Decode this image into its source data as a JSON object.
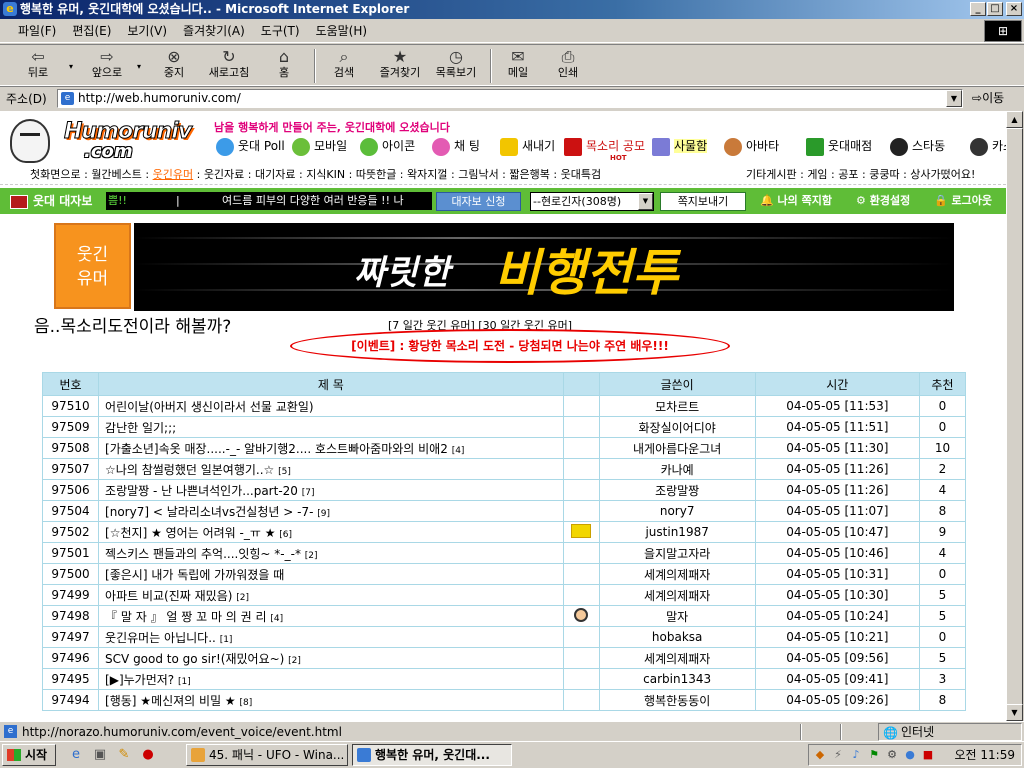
{
  "window": {
    "title": "행복한 유머, 웃긴대학에 오셨습니다.. - Microsoft Internet Explorer",
    "min": "_",
    "max": "□",
    "close": "×"
  },
  "menu": [
    "파일(F)",
    "편집(E)",
    "보기(V)",
    "즐겨찾기(A)",
    "도구(T)",
    "도움말(H)"
  ],
  "toolbar": [
    {
      "label": "뒤로",
      "icon": "back-arrow-icon",
      "glyph": "⇦"
    },
    {
      "label": "앞으로",
      "icon": "forward-arrow-icon",
      "glyph": "⇨"
    },
    {
      "label": "중지",
      "icon": "stop-icon",
      "glyph": "⊗"
    },
    {
      "label": "새로고침",
      "icon": "refresh-icon",
      "glyph": "↻"
    },
    {
      "label": "홈",
      "icon": "home-icon",
      "glyph": "⌂"
    },
    {
      "label": "검색",
      "icon": "search-icon",
      "glyph": "⌕"
    },
    {
      "label": "즐겨찾기",
      "icon": "favorites-icon",
      "glyph": "★"
    },
    {
      "label": "목록보기",
      "icon": "history-icon",
      "glyph": "◷"
    },
    {
      "label": "메일",
      "icon": "mail-icon",
      "glyph": "✉"
    },
    {
      "label": "인쇄",
      "icon": "print-icon",
      "glyph": "⎙"
    }
  ],
  "address": {
    "label": "주소(D)",
    "url": "http://web.humoruniv.com/",
    "go": "이동"
  },
  "site": {
    "logo_line1": "Humoruniv",
    "logo_line2": ".com",
    "slogan": "남을 행복하게 만들어 주는, 웃긴대학에 오셨습니다",
    "nav": [
      {
        "label": "웃대 Poll",
        "color": "#3c9be8"
      },
      {
        "label": "모바일",
        "color": "#6bbf3a"
      },
      {
        "label": "아이콘",
        "color": "#5bbd3a"
      },
      {
        "label": "채 팅",
        "color": "#e35bb3"
      },
      {
        "label": "새내기",
        "color": "#f2c500"
      },
      {
        "label": "목소리 공모",
        "color": "#cc1111",
        "badge": "HOT"
      },
      {
        "label": "사물함",
        "color": "#7b7bd6"
      },
      {
        "label": "아바타",
        "color": "#c97a3a"
      },
      {
        "label": "웃대매점",
        "color": "#2a9a2a"
      },
      {
        "label": "스타동",
        "color": "#222222"
      },
      {
        "label": "카스",
        "color": "#333333"
      }
    ],
    "subnav_left": [
      "첫화면으로",
      "월간베스트",
      "웃긴유머",
      "웃긴자료",
      "대기자료",
      "지식KIN",
      "따뜻한글",
      "왁자지껄",
      "그림낙서",
      "짧은행복",
      "웃대특검"
    ],
    "subnav_active": "웃긴유머",
    "subnav_right": [
      "기타게시판",
      "게임",
      "공포",
      "쿵쿵따",
      "상사가떴어요!"
    ],
    "greenbar": {
      "title": "웃대 대자보",
      "ticker_a": "쁨!!",
      "ticker_b": "|",
      "ticker_c": "여드름 피부의 다양한 여러 반응들 !! 나",
      "apply": "대자보 신청",
      "online": "--현로긴자(308명)",
      "msg": "쪽지보내기",
      "links": [
        "나의 쪽지함",
        "환경설정",
        "로그아웃"
      ]
    },
    "banner_left": [
      "웃긴",
      "유머"
    ],
    "banner_white": "짜릿한",
    "banner_yellow": "비행전투",
    "page_title": "음..목소리도전이라 해볼까?",
    "top_links": "[7 일간 웃긴 유머]   [30 일간 웃긴 유머]",
    "event_link": "[이벤트] : 황당한 목소리 도전 - 당첨되면 나는야 주연 배우!!!"
  },
  "board": {
    "headers": [
      "번호",
      "제          목",
      "",
      "글쓴이",
      "시간",
      "추천"
    ],
    "rows": [
      {
        "no": "97510",
        "title": "어린이날(아버지 생신이라서 선물 교환일)",
        "cmt": "",
        "icon": "",
        "writer": "모차르트",
        "date": "04-05-05 [11:53]",
        "rec": "0"
      },
      {
        "no": "97509",
        "title": "감난한 일기;;;",
        "cmt": "",
        "icon": "",
        "writer": "화장실이어디야",
        "date": "04-05-05 [11:51]",
        "rec": "0"
      },
      {
        "no": "97508",
        "title": "[가출소년]속옷 매장.....-_- 알바기행2.... 호스트빠아줌마와의 비애2",
        "cmt": "[4]",
        "icon": "",
        "writer": "내게아름다운그녀",
        "date": "04-05-05 [11:30]",
        "rec": "10"
      },
      {
        "no": "97507",
        "title": "☆나의 참썰렁했던 일본여행기..☆",
        "cmt": "[5]",
        "icon": "",
        "writer": "카나예",
        "date": "04-05-05 [11:26]",
        "rec": "2"
      },
      {
        "no": "97506",
        "title": "조랑말짱 - 난 나쁜녀석인가...part-20",
        "cmt": "[7]",
        "icon": "",
        "writer": "조랑말짱",
        "date": "04-05-05 [11:26]",
        "rec": "4"
      },
      {
        "no": "97504",
        "title": "[nory7] < 날라리소녀vs건실청년 > -7-",
        "cmt": "[9]",
        "icon": "",
        "writer": "nory7",
        "date": "04-05-05 [11:07]",
        "rec": "8"
      },
      {
        "no": "97502",
        "title": "[☆천지] ★ 영어는 어려워 -_ㅠ ★",
        "cmt": "[6]",
        "icon": "badge",
        "writer": "justin1987",
        "date": "04-05-05 [10:47]",
        "rec": "9"
      },
      {
        "no": "97501",
        "title": "젝스키스 팬들과의 추억....잇힝~ *-_-*",
        "cmt": "[2]",
        "icon": "",
        "writer": "을지말고자라",
        "date": "04-05-05 [10:46]",
        "rec": "4"
      },
      {
        "no": "97500",
        "title": "[좋은시] 내가 독립에 가까워졌을 때",
        "cmt": "",
        "icon": "",
        "writer": "세계의제패자",
        "date": "04-05-05 [10:31]",
        "rec": "0"
      },
      {
        "no": "97499",
        "title": "아파트 비교(진짜 재밌음)",
        "cmt": "[2]",
        "icon": "",
        "writer": "세계의제패자",
        "date": "04-05-05 [10:30]",
        "rec": "5"
      },
      {
        "no": "97498",
        "title": "『 말 자 』 얼 짱 꼬 마 의 권 리",
        "cmt": "[4]",
        "icon": "face",
        "writer": "말자",
        "date": "04-05-05 [10:24]",
        "rec": "5"
      },
      {
        "no": "97497",
        "title": "웃긴유머는 아닙니다..",
        "cmt": "[1]",
        "icon": "",
        "writer": "hobaksa",
        "date": "04-05-05 [10:21]",
        "rec": "0"
      },
      {
        "no": "97496",
        "title": "SCV good to go sir!(재밌어요~)",
        "cmt": "[2]",
        "icon": "",
        "writer": "세계의제패자",
        "date": "04-05-05 [09:56]",
        "rec": "5"
      },
      {
        "no": "97495",
        "title": "[▶]누가먼저?",
        "cmt": "[1]",
        "icon": "",
        "writer": "carbin1343",
        "date": "04-05-05 [09:41]",
        "rec": "3"
      },
      {
        "no": "97494",
        "title": "[행동] ★메신져의 비밀 ★",
        "cmt": "[8]",
        "icon": "",
        "writer": "행복한동동이",
        "date": "04-05-05 [09:26]",
        "rec": "8"
      }
    ]
  },
  "status": {
    "url": "http://norazo.humoruniv.com/event_voice/event.html",
    "zone": "인터넷"
  },
  "taskbar": {
    "start": "시작",
    "tasks": [
      {
        "label": "45. 패닉 - UFO - Wina...",
        "color": "#e8a33a",
        "active": false
      },
      {
        "label": "행복한 유머, 웃긴대...",
        "color": "#3a7bd5",
        "active": true
      }
    ],
    "clock": "오전 11:59"
  }
}
